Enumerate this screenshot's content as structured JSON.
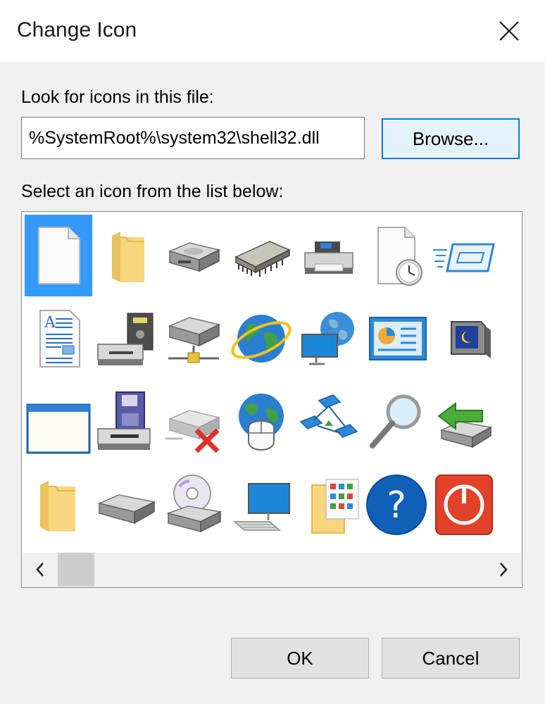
{
  "dialog": {
    "title": "Change Icon",
    "close_icon": "close-icon"
  },
  "file": {
    "label": "Look for icons in this file:",
    "value": "%SystemRoot%\\system32\\shell32.dll",
    "browse_label": "Browse..."
  },
  "list": {
    "label": "Select an icon from the list below:",
    "icons": [
      [
        "blank-document-icon",
        "folder-icon",
        "drive-icon",
        "memory-chip-icon",
        "printer-icon",
        "document-clock-icon",
        "window-speed-icon"
      ],
      [
        "text-document-icon",
        "floppy-drive-icon",
        "network-drive-icon",
        "internet-globe-icon",
        "network-globe-icon",
        "control-panel-icon",
        "monitor-moon-icon"
      ],
      [
        "window-icon",
        "floppy-disk-drive-icon",
        "disconnected-drive-icon",
        "globe-mouse-icon",
        "network-icon",
        "search-magnifier-icon",
        "removable-drive-arrow-icon"
      ],
      [
        "folder-icon",
        "hard-drive-icon",
        "cd-drive-icon",
        "computer-icon",
        "folder-grid-icon",
        "help-question-icon",
        "power-icon"
      ]
    ],
    "scroll_left_icon": "chevron-left-icon",
    "scroll_right_icon": "chevron-right-icon"
  },
  "buttons": {
    "ok": "OK",
    "cancel": "Cancel"
  },
  "colors": {
    "selection": "#3399ff",
    "accent": "#0078d7"
  }
}
